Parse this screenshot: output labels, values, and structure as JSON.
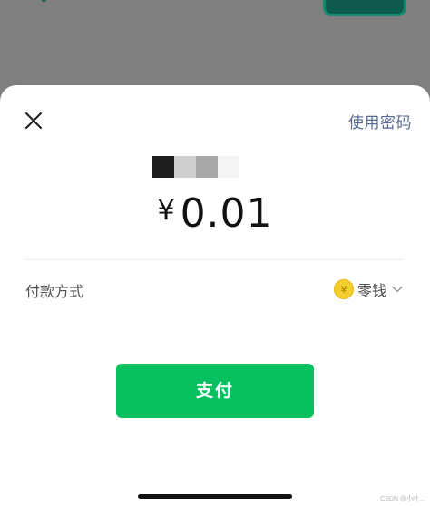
{
  "header": {
    "use_password_label": "使用密码"
  },
  "payment": {
    "currency_symbol": "¥",
    "amount": "0.01"
  },
  "pay_method": {
    "label": "付款方式",
    "selected_value": "零钱",
    "coin_glyph": "¥"
  },
  "actions": {
    "pay_label": "支付"
  },
  "watermark": {
    "text": "CSDN @小叶..."
  },
  "colors": {
    "accent_green": "#07c160",
    "link_blue": "#576b95",
    "coin_gold": "#f3cf2b"
  },
  "icons": {
    "close": "close-icon",
    "coin": "coin-icon",
    "chevron": "chevron-down-icon"
  }
}
